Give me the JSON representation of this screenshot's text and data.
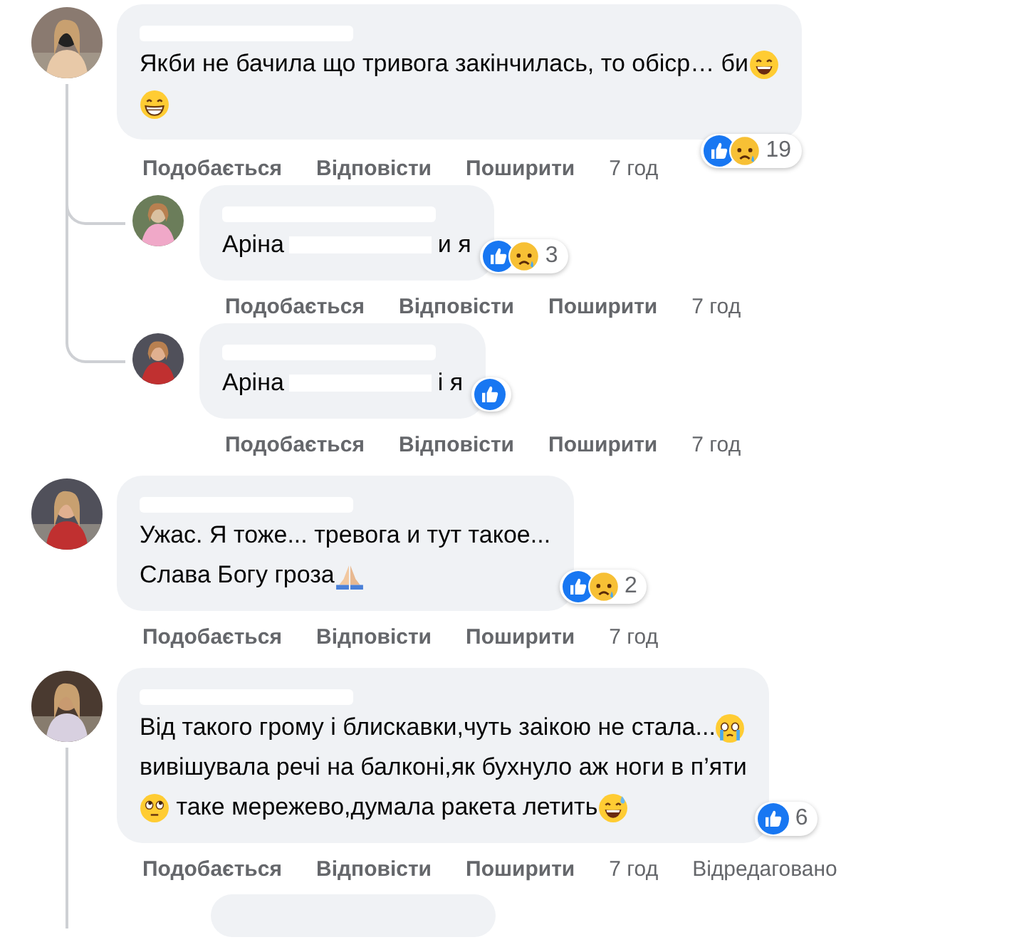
{
  "comments": [
    {
      "body": [
        [
          {
            "kind": "text",
            "text": "Якби не бачила що тривога закінчилась, то обіср… би"
          },
          {
            "kind": "smile"
          }
        ],
        [
          {
            "kind": "grin"
          }
        ]
      ],
      "reactions": [
        {
          "kind": "like"
        },
        {
          "kind": "sad"
        }
      ],
      "reaction_count": "19",
      "actions": [
        "Подобається",
        "Відповісти",
        "Поширити"
      ],
      "time": "7 год",
      "replies": [
        {
          "body": [
            [
              {
                "kind": "text",
                "text": "Аріна"
              },
              {
                "kind": "redaction"
              },
              {
                "kind": "text",
                "text": "и я"
              }
            ]
          ],
          "reactions": [
            {
              "kind": "like"
            },
            {
              "kind": "sad"
            }
          ],
          "reaction_count": "3",
          "actions": [
            "Подобається",
            "Відповісти",
            "Поширити"
          ],
          "time": "7 год"
        },
        {
          "body": [
            [
              {
                "kind": "text",
                "text": "Аріна"
              },
              {
                "kind": "redaction"
              },
              {
                "kind": "text",
                "text": "і я"
              }
            ]
          ],
          "reactions": [
            {
              "kind": "like"
            }
          ],
          "actions": [
            "Подобається",
            "Відповісти",
            "Поширити"
          ],
          "time": "7 год"
        }
      ]
    },
    {
      "body": [
        [
          {
            "kind": "text",
            "text": "Ужас. Я тоже... тревога и тут такое..."
          }
        ],
        [
          {
            "kind": "text",
            "text": "Слава Богу гроза"
          },
          {
            "kind": "pray"
          }
        ]
      ],
      "reactions": [
        {
          "kind": "like"
        },
        {
          "kind": "sad"
        }
      ],
      "reaction_count": "2",
      "actions": [
        "Подобається",
        "Відповісти",
        "Поширити"
      ],
      "time": "7 год"
    },
    {
      "body": [
        [
          {
            "kind": "text",
            "text": "Від такого грому і блискавки,чуть заікою не стала..."
          },
          {
            "kind": "cry"
          }
        ],
        [
          {
            "kind": "text",
            "text": "вивішувала речі на балконі,як бухнуло аж ноги в п’яти"
          }
        ],
        [
          {
            "kind": "rolleyes"
          },
          {
            "kind": "text",
            "text": " таке мережево,думала ракета летить"
          },
          {
            "kind": "sweat"
          }
        ]
      ],
      "reactions": [
        {
          "kind": "like"
        }
      ],
      "reaction_count": "6",
      "actions": [
        "Подобається",
        "Відповісти",
        "Поширити"
      ],
      "time": "7 год",
      "edited": "Відредаговано",
      "more_replies": true
    }
  ]
}
